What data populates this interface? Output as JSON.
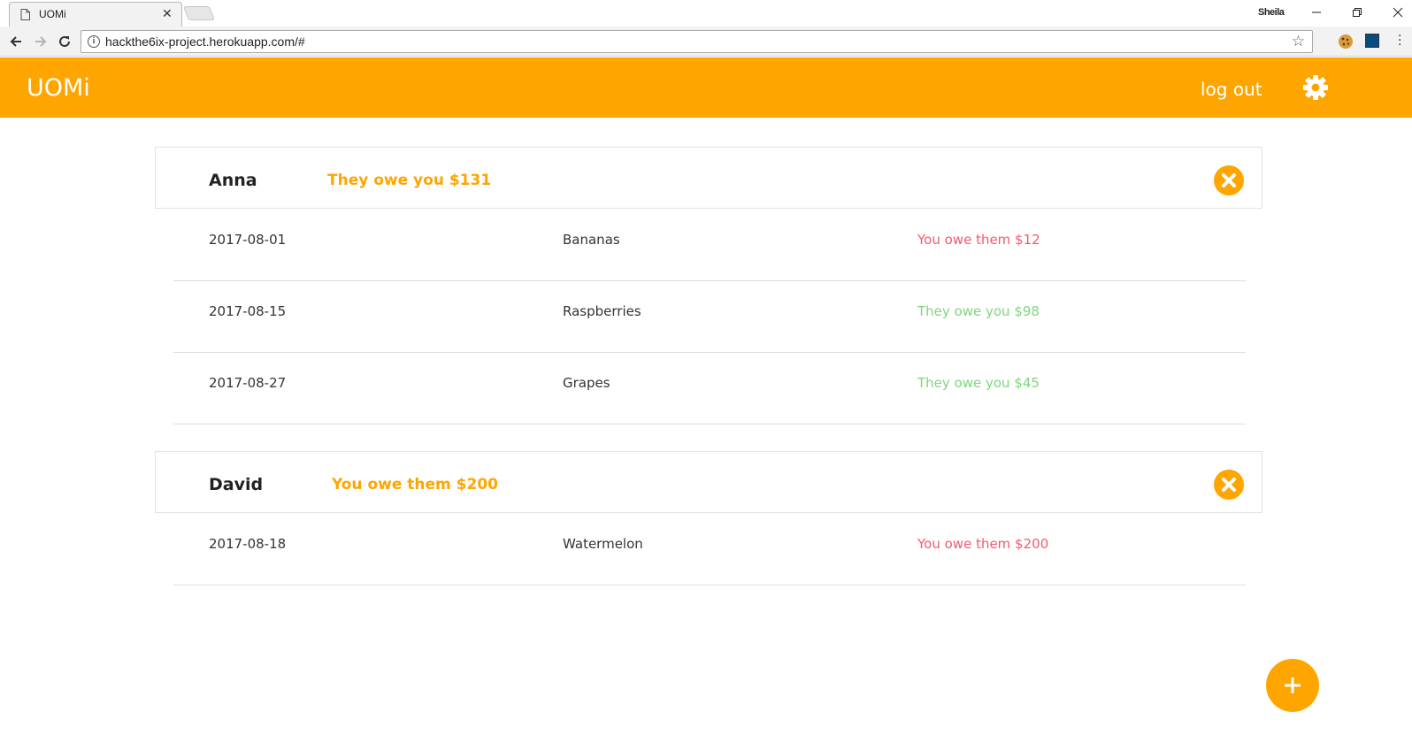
{
  "browser": {
    "tab_title": "UOMi",
    "tab_close": "✕",
    "profile_name": "Sheila",
    "url": "hackthe6ix-project.herokuapp.com/#"
  },
  "app": {
    "brand": "UOMi",
    "logout_label": "log out",
    "accent_color": "#ffa500",
    "owe_color": "#f25a6e",
    "owed_color": "#7ed67e"
  },
  "people": [
    {
      "name": "Anna",
      "summary": "They owe you $131",
      "transactions": [
        {
          "date": "2017-08-01",
          "item": "Bananas",
          "amount": "You owe them $12",
          "direction": "owe"
        },
        {
          "date": "2017-08-15",
          "item": "Raspberries",
          "amount": "They owe you $98",
          "direction": "owed"
        },
        {
          "date": "2017-08-27",
          "item": "Grapes",
          "amount": "They owe you $45",
          "direction": "owed"
        }
      ]
    },
    {
      "name": "David",
      "summary": "You owe them $200",
      "transactions": [
        {
          "date": "2017-08-18",
          "item": "Watermelon",
          "amount": "You owe them $200",
          "direction": "owe"
        }
      ]
    }
  ]
}
